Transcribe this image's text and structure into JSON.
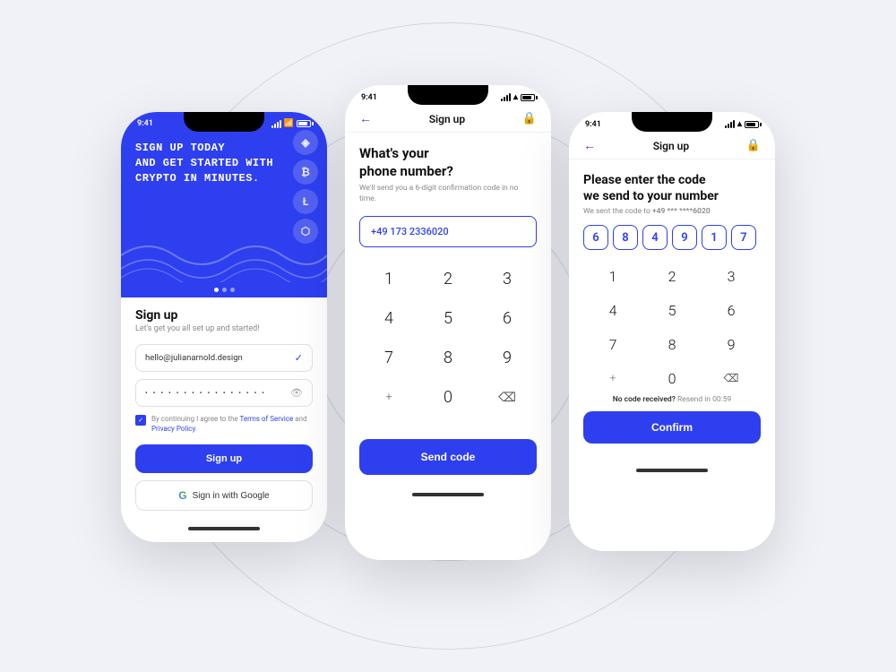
{
  "background": "#f0f2f8",
  "brand_color": "#2e3ff0",
  "phone1": {
    "status_time": "9:41",
    "hero_text": "SIGN UP TODAY\nAND GET STARTED WITH\nCRYPTO IN MINUTES.",
    "signup_title": "Sign up",
    "signup_subtitle": "Let's get you all set up and started!",
    "email_value": "hello@julianarnold.design",
    "password_placeholder": "••••••••••••••••••",
    "terms_text": "By continuing I agree to the",
    "terms_link1": "Terms of Service",
    "terms_and": "and",
    "terms_link2": "Privacy Policy",
    "signup_button": "Sign up",
    "google_button": "Sign in with Google"
  },
  "phone2": {
    "status_time": "9:41",
    "page_title": "Sign up",
    "question": "What's your\nphone number?",
    "description": "We'll send you a 6-digit confirmation code in no time.",
    "phone_value": "+49  173 2336020",
    "numpad": [
      "1",
      "2",
      "3",
      "4",
      "5",
      "6",
      "7",
      "8",
      "9",
      "+",
      "0",
      "⌫"
    ],
    "send_code_button": "Send code"
  },
  "phone3": {
    "status_time": "9:41",
    "page_title": "Sign up",
    "question": "Please enter the code\nwe send to your number",
    "sent_to_prefix": "We sent the code to",
    "sent_to_number": "+49 *** ****6020",
    "code_digits": [
      "6",
      "8",
      "4",
      "9",
      "1",
      "7"
    ],
    "numpad": [
      "1",
      "2",
      "3",
      "4",
      "5",
      "6",
      "7",
      "8",
      "9",
      "+",
      "0",
      "⌫"
    ],
    "no_code_text": "No code received?",
    "resend_text": "Resend in 00:59",
    "confirm_button": "Confirm"
  }
}
